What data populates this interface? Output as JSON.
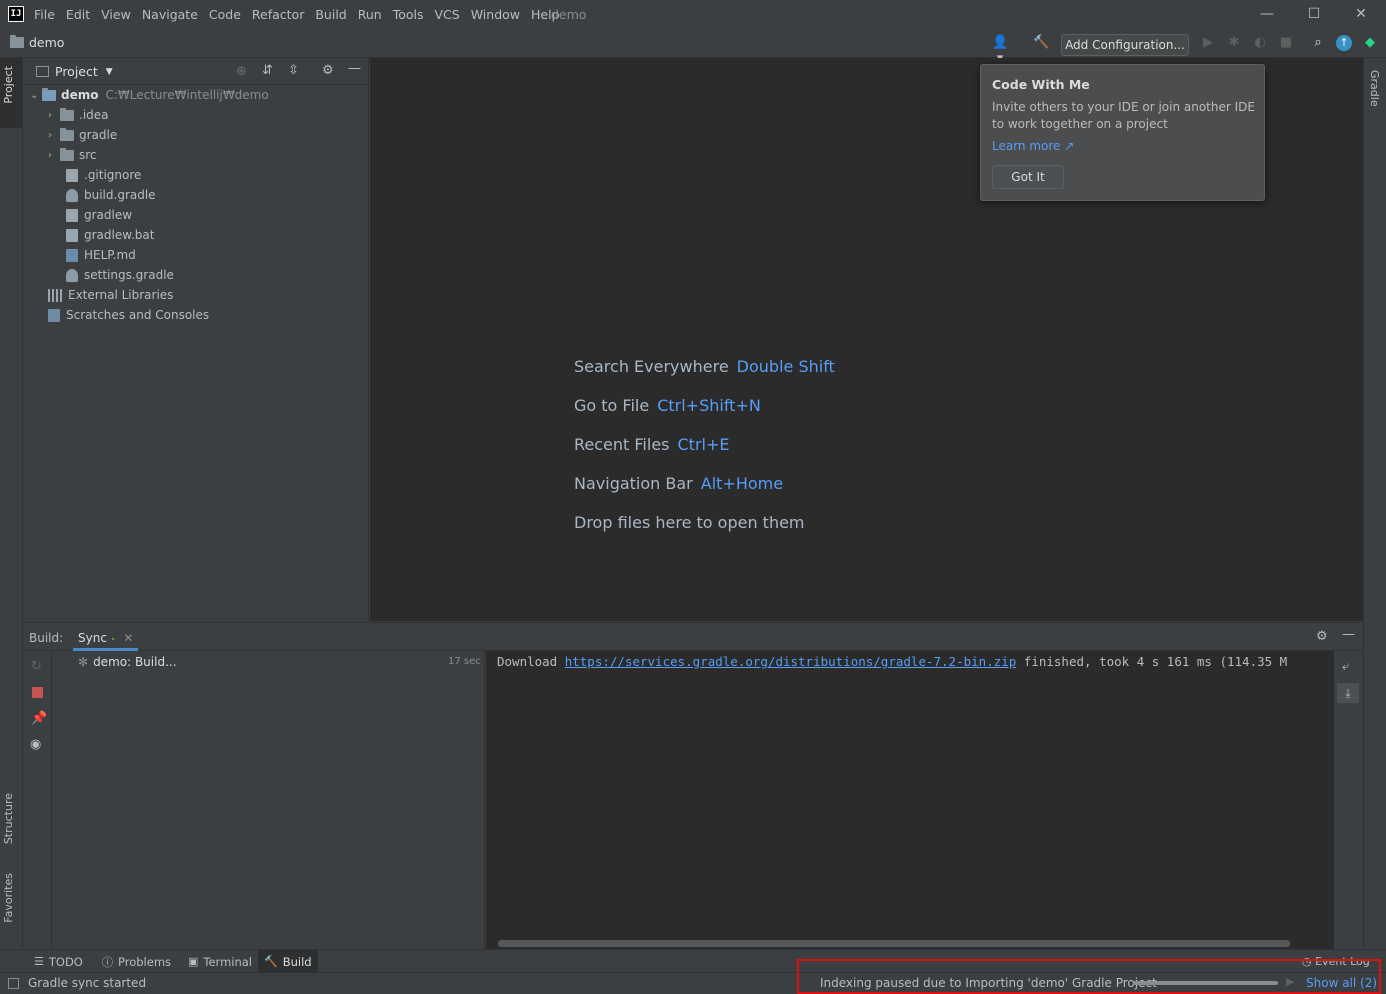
{
  "menubar": {
    "logo": "IJ",
    "items": [
      "File",
      "Edit",
      "View",
      "Navigate",
      "Code",
      "Refactor",
      "Build",
      "Run",
      "Tools",
      "VCS",
      "Window",
      "Help"
    ],
    "window_title": "demo"
  },
  "navbar": {
    "project": "demo",
    "add_configuration": "Add Configuration..."
  },
  "left_strip": {
    "project": "Project",
    "structure": "Structure",
    "favorites": "Favorites"
  },
  "right_strip": {
    "gradle": "Gradle"
  },
  "project_panel": {
    "title": "Project",
    "tree": [
      {
        "label": "demo",
        "hint": "C:₩Lecture₩intellij₩demo"
      },
      {
        "label": ".idea"
      },
      {
        "label": "gradle"
      },
      {
        "label": "src"
      },
      {
        "label": ".gitignore"
      },
      {
        "label": "build.gradle"
      },
      {
        "label": "gradlew"
      },
      {
        "label": "gradlew.bat"
      },
      {
        "label": "HELP.md"
      },
      {
        "label": "settings.gradle"
      },
      {
        "label": "External Libraries"
      },
      {
        "label": "Scratches and Consoles"
      }
    ]
  },
  "editor": {
    "hints": [
      {
        "label": "Search Everywhere",
        "key": "Double Shift"
      },
      {
        "label": "Go to File",
        "key": "Ctrl+Shift+N"
      },
      {
        "label": "Recent Files",
        "key": "Ctrl+E"
      },
      {
        "label": "Navigation Bar",
        "key": "Alt+Home"
      },
      {
        "label": "Drop files here to open them",
        "key": ""
      }
    ]
  },
  "popup": {
    "title": "Code With Me",
    "text": "Invite others to your IDE or join another IDE to work together on a project",
    "link": "Learn more ↗",
    "button": "Got It"
  },
  "build": {
    "label": "Build:",
    "tab": "Sync",
    "tree_item": "demo: Build...",
    "tree_time": "17 sec",
    "console_prefix": "Download ",
    "console_url": "https://services.gradle.org/distributions/gradle-7.2-bin.zip",
    "console_suffix": " finished, took 4 s 161 ms (114.35 M"
  },
  "bottom_bar": {
    "tabs": [
      "TODO",
      "Problems",
      "Terminal",
      "Build"
    ],
    "event_log": "Event Log"
  },
  "status": {
    "text": "Gradle sync started",
    "indexing": "Indexing paused due to Importing 'demo' Gradle Project",
    "progress": 1.0,
    "show_all": "Show all (2)"
  }
}
